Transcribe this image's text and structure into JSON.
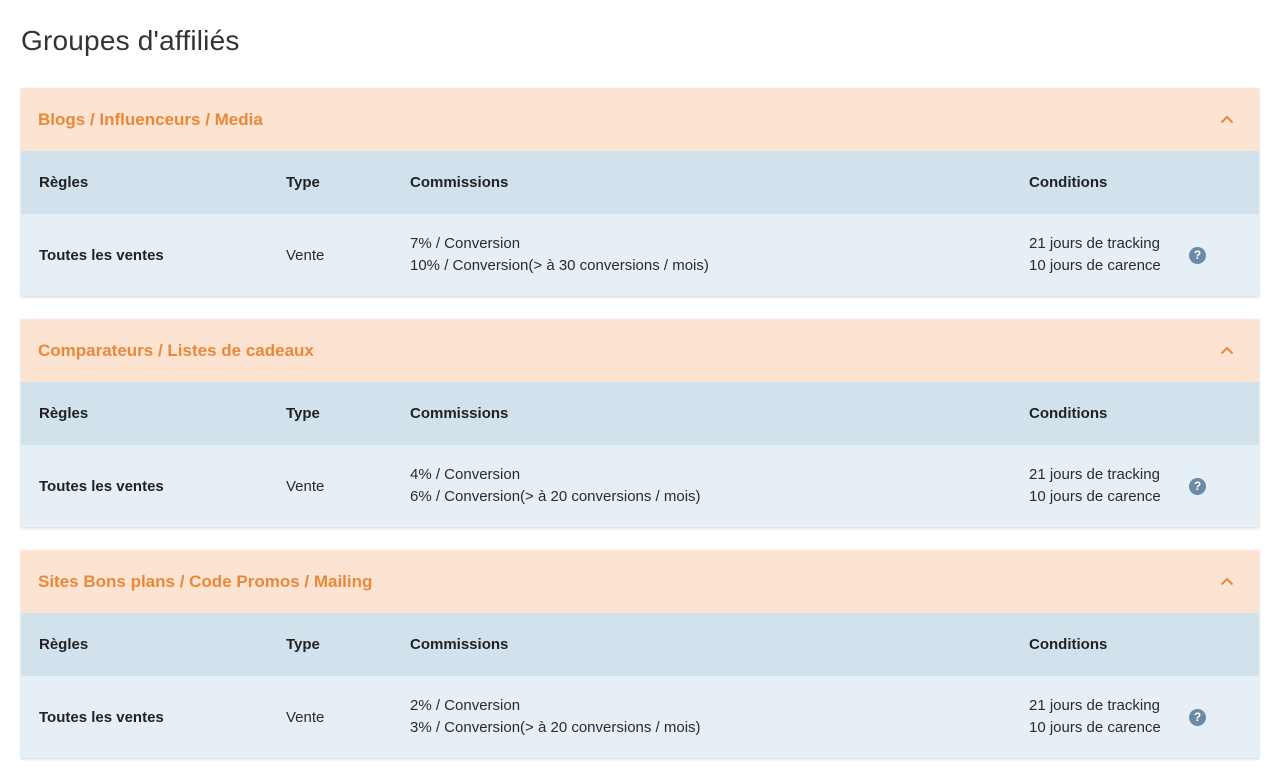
{
  "page": {
    "title": "Groupes d'affiliés"
  },
  "columns": {
    "rules": "Règles",
    "type": "Type",
    "commissions": "Commissions",
    "conditions": "Conditions"
  },
  "groups": [
    {
      "title": "Blogs / Influenceurs / Media",
      "row": {
        "rules": "Toutes les ventes",
        "type": "Vente",
        "commission_1": "7% / Conversion",
        "commission_2": "10% / Conversion(> à 30 conversions / mois)",
        "condition_1": "21 jours de tracking",
        "condition_2": "10 jours de carence"
      }
    },
    {
      "title": "Comparateurs / Listes de cadeaux",
      "row": {
        "rules": "Toutes les ventes",
        "type": "Vente",
        "commission_1": "4% / Conversion",
        "commission_2": "6% / Conversion(> à 20 conversions / mois)",
        "condition_1": "21 jours de tracking",
        "condition_2": "10 jours de carence"
      }
    },
    {
      "title": "Sites Bons plans / Code Promos / Mailing",
      "row": {
        "rules": "Toutes les ventes",
        "type": "Vente",
        "commission_1": "2% / Conversion",
        "commission_2": "3% / Conversion(> à 20 conversions / mois)",
        "condition_1": "21 jours de tracking",
        "condition_2": "10 jours de carence"
      }
    }
  ],
  "icons": {
    "chevron": "chevron-up-icon",
    "help": "question-circle-icon",
    "help_glyph": "?"
  },
  "colors": {
    "header_bg": "#fde3d2",
    "header_text": "#e8893a",
    "table_head_bg": "#d2e2ec",
    "table_row_bg": "#e6eff5",
    "help_icon": "#6a8aa6"
  }
}
